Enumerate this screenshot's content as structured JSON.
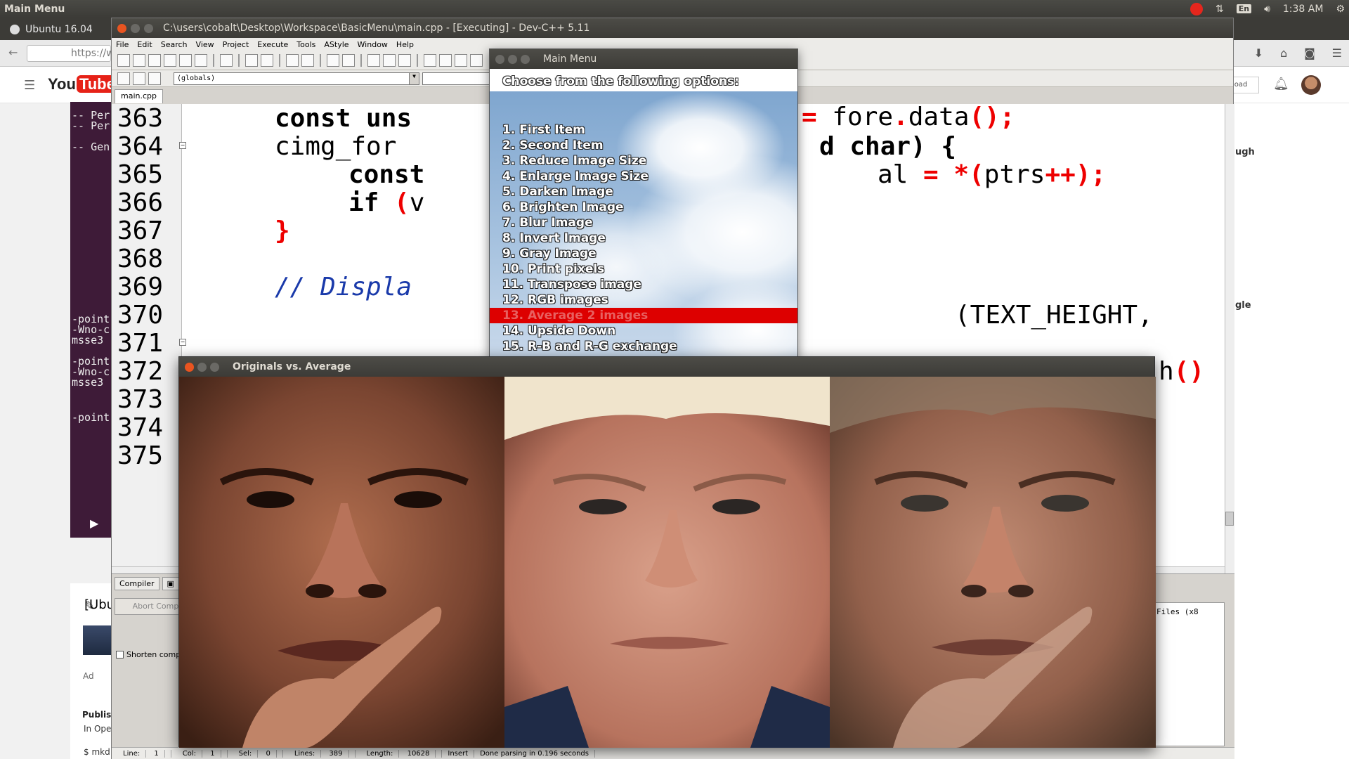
{
  "topbar": {
    "title": "Main Menu",
    "language": "En",
    "clock": "1:38 AM"
  },
  "firefox": {
    "tab_label": "Ubuntu 16.04",
    "url": "https://w"
  },
  "youtube": {
    "logo_you": "You",
    "logo_tube": "Tube",
    "upload_label": "oad",
    "right_text_1": "ugh",
    "right_text_2": "gle",
    "video_title_partial": "[Ubu",
    "add_label": "Ad",
    "published": "Publish",
    "in_open": "In Ope",
    "mkdir": "$ mkd",
    "terminal_lines": [
      "-- Per",
      "-- Per",
      "-- Gen",
      "-point",
      "-Wno-c",
      "msse3",
      "-point",
      "-Wno-c",
      "msse3",
      "-point"
    ]
  },
  "devcpp": {
    "title": "C:\\users\\cobalt\\Desktop\\Workspace\\BasicMenu\\main.cpp - [Executing] - Dev-C++ 5.11",
    "menu": [
      "File",
      "Edit",
      "Search",
      "View",
      "Project",
      "Execute",
      "Tools",
      "AStyle",
      "Window",
      "Help"
    ],
    "globals_select": "(globals)",
    "file_tab": "main.cpp",
    "line_numbers": [
      "363",
      "364",
      "365",
      "366",
      "367",
      "368",
      "369",
      "370",
      "371",
      "372",
      "373",
      "374",
      "375"
    ],
    "code": {
      "l363_a": "const uns",
      "l363_b": "= fore.data();",
      "l364_a": "cimg_for",
      "l364_b": "d char) {",
      "l365_a": "const",
      "l365_b": "al = *(ptrs++);",
      "l366_a": "if (v",
      "l367_a": "}",
      "l369_a": "// Displa",
      "l370_b": "(TEXT_HEIGHT,",
      "l372_b": "h()"
    },
    "bottom": {
      "tab_compiler": "Compiler",
      "abort_label": "Abort Compi",
      "shorten_label": "Shorten compil",
      "output_text": "Files (x8"
    },
    "status": {
      "line_label": "Line:",
      "line": "1",
      "col_label": "Col:",
      "col": "1",
      "sel_label": "Sel:",
      "sel": "0",
      "lines_label": "Lines:",
      "lines": "389",
      "length_label": "Length:",
      "length": "10628",
      "mode": "Insert",
      "message": "Done parsing in 0.196 seconds"
    }
  },
  "main_menu_window": {
    "title": "Main Menu",
    "heading": "Choose from the following options:",
    "items": [
      "1. First Item",
      "2. Second Item",
      "3. Reduce Image Size",
      "4. Enlarge Image Size",
      "5. Darken Image",
      "6. Brighten Image",
      "7. Blur Image",
      "8. Invert Image",
      "9. Gray Image",
      "10. Print pixels",
      "11. Transpose image",
      "12. RGB images",
      "13. Average 2 images",
      "14. Upside Down",
      "15. R-B and R-G exchange"
    ],
    "selected_index": 12
  },
  "average_window": {
    "title": "Originals vs. Average"
  }
}
